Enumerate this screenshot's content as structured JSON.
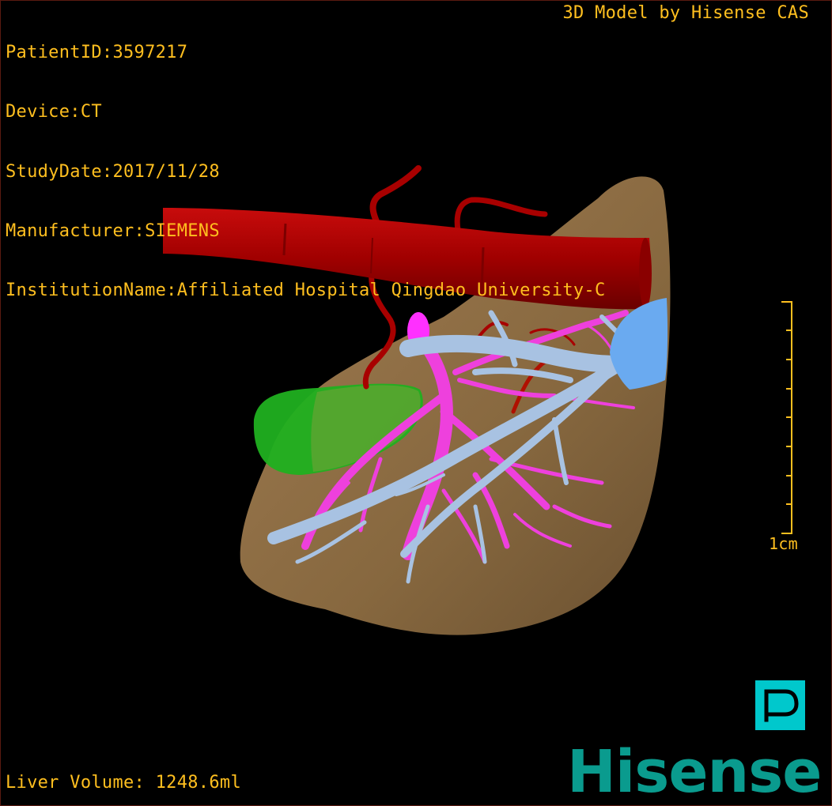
{
  "overlay": {
    "patient_id": "PatientID:3597217",
    "device": "Device:CT",
    "study_date": "StudyDate:2017/11/28",
    "manufacturer": "Manufacturer:SIEMENS",
    "institution": "InstitutionName:Affiliated Hospital Qingdao University-C",
    "model_credit": "3D Model by Hisense CAS",
    "liver_volume": "Liver Volume: 1248.6ml"
  },
  "scale": {
    "label": "1cm"
  },
  "brand": {
    "logo_text": "Hisense"
  },
  "icons": {
    "view_mode": "view-mode-icon"
  },
  "colors": {
    "overlay_text": "#ffbf1f",
    "liver": "#8a6a44",
    "artery": "#b00000",
    "portal_vein": "#ee40dd",
    "hepatic_vein": "#a9c4e4",
    "ivc": "#6aaaf0",
    "gallbladder": "#22a222",
    "brand": "#0a9b8e",
    "view_button": "#00c8cc"
  }
}
